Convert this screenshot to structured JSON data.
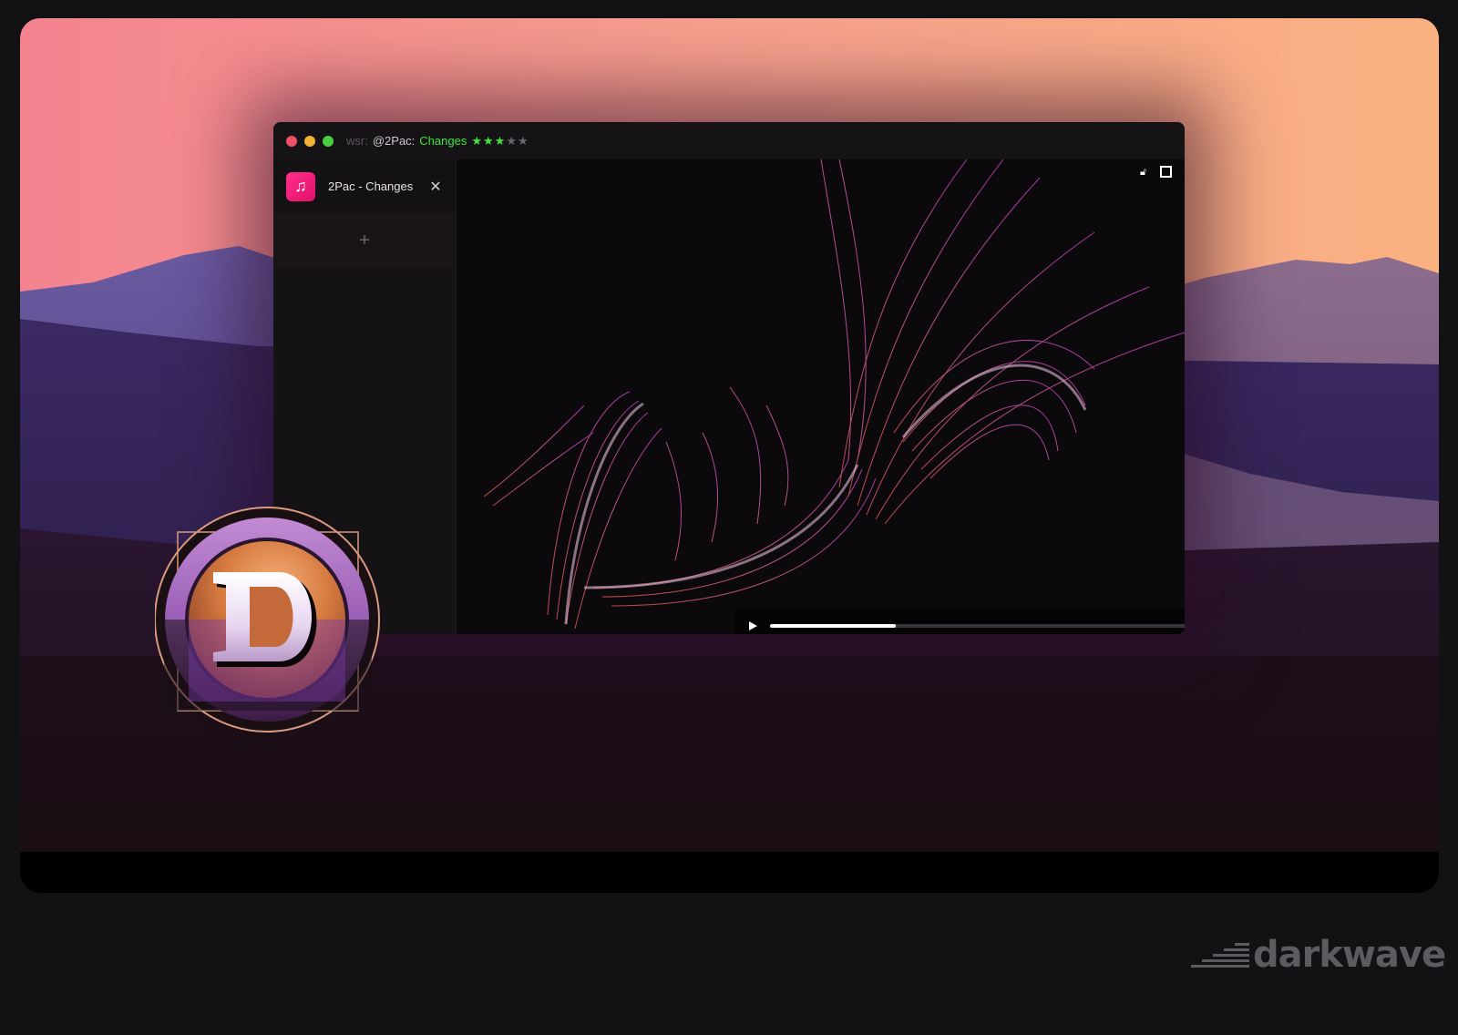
{
  "window": {
    "title": {
      "prefix": "wsr:",
      "artist": "@2Pac:",
      "track": "Changes",
      "rating": 3,
      "rating_max": 5
    },
    "traffic_lights": [
      "close",
      "minimize",
      "maximize"
    ]
  },
  "sidebar": {
    "tabs": [
      {
        "label": "2Pac - Changes",
        "icon": "music-note-icon",
        "close_glyph": "✕"
      }
    ],
    "add_glyph": "+"
  },
  "visualizer": {
    "icons": [
      "unlock-icon",
      "maximize-icon"
    ]
  },
  "player": {
    "progress": 0.28
  },
  "brand": {
    "name": "darkwave"
  },
  "colors": {
    "accent_green": "#3fe63a",
    "tab_icon": "#ff1f7d",
    "visual_pink": "#d44fb8",
    "visual_red": "#e0525a"
  }
}
